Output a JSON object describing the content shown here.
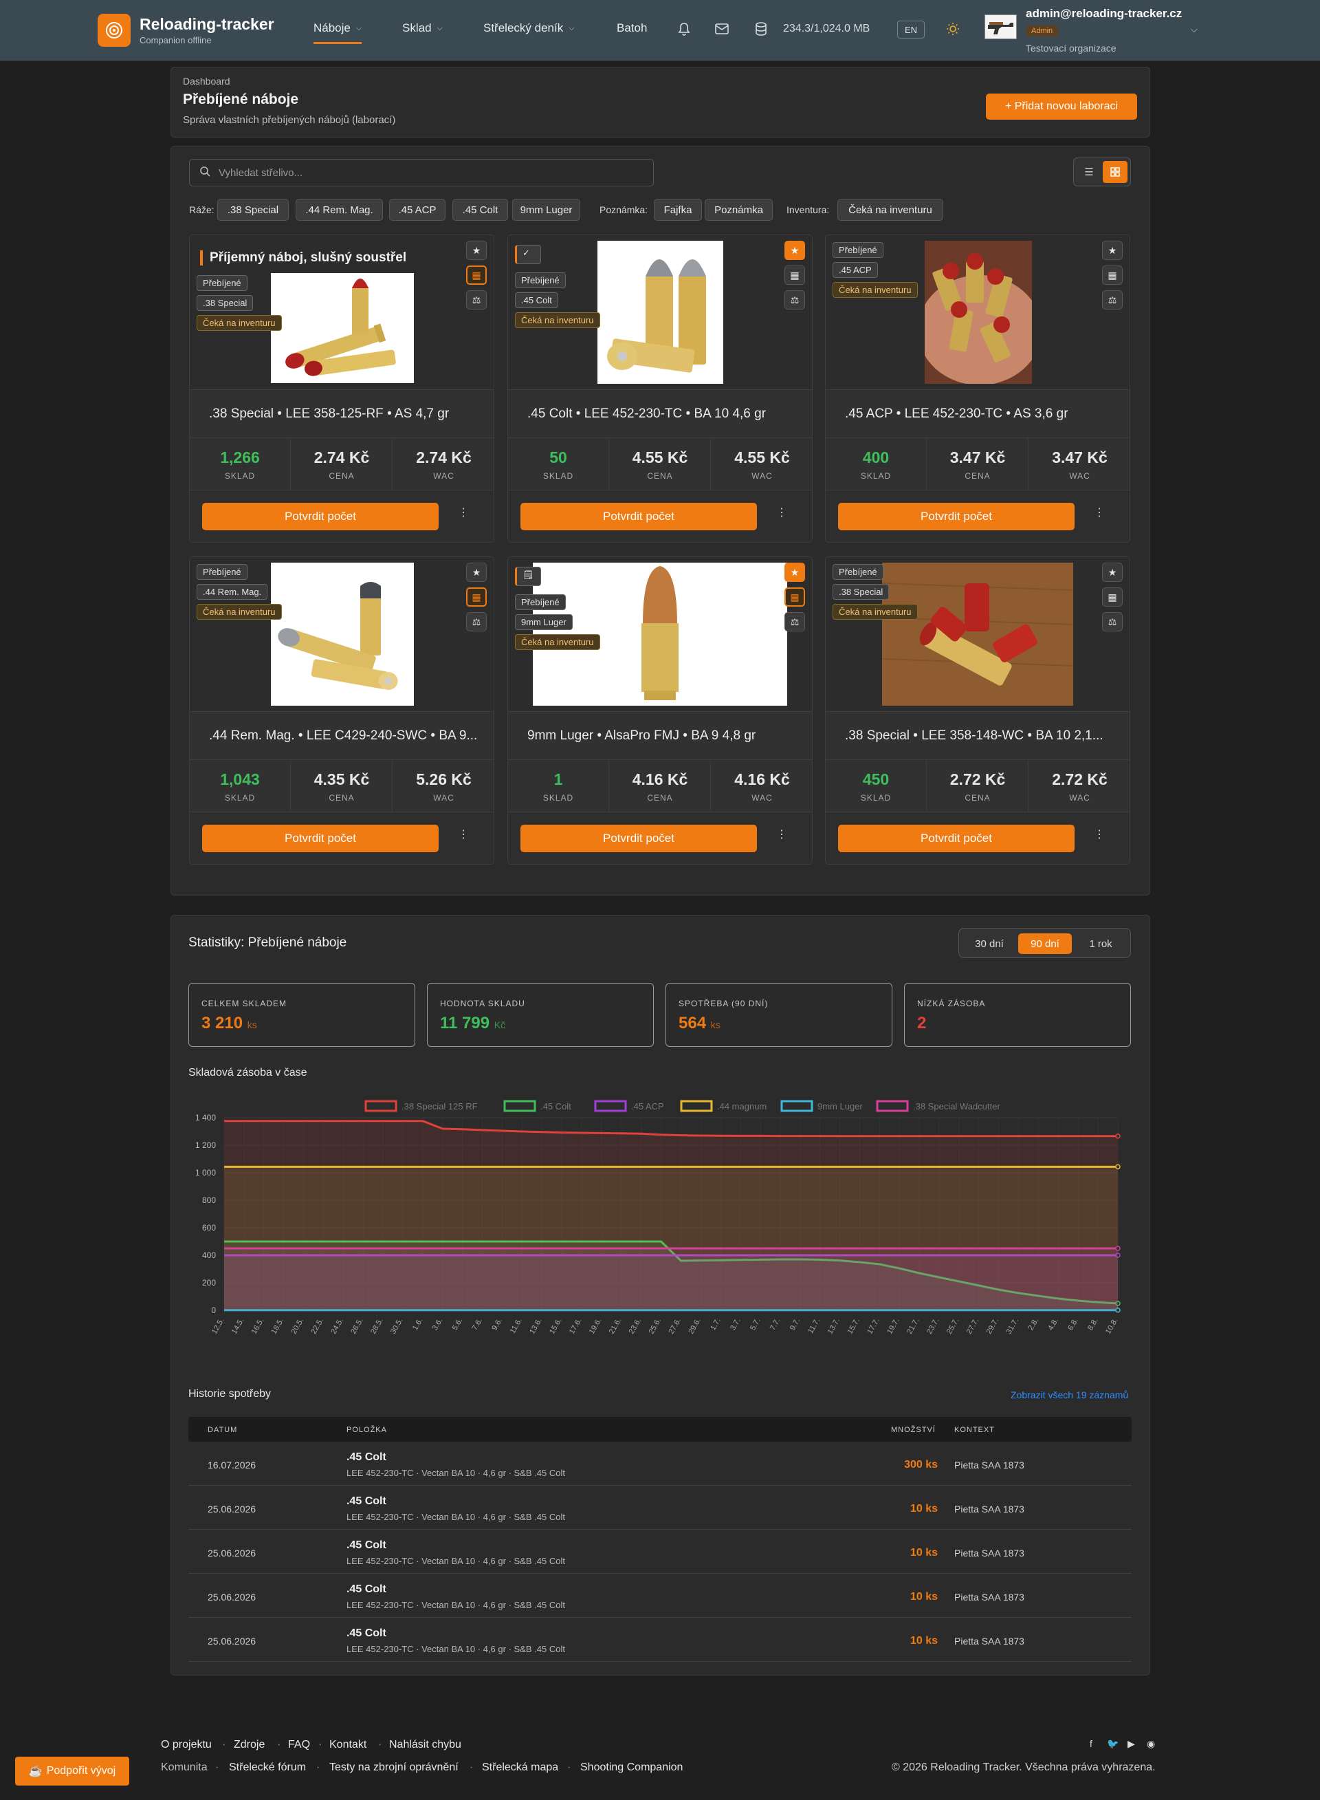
{
  "header": {
    "brand": "Reloading-tracker",
    "brand_sub": "Companion offline",
    "nav": [
      "Náboje",
      "Sklad",
      "Střelecký deník",
      "Batoh"
    ],
    "storage": "234.3/1,024.0 MB",
    "lang": "EN",
    "user_email": "admin@reloading-tracker.cz",
    "user_role": "Admin",
    "user_org": "Testovací organizace"
  },
  "page": {
    "breadcrumb": "Dashboard",
    "title": "Přebíjené náboje",
    "subtitle": "Správa vlastních přebíjených nábojů (laborací)",
    "add_button": "+ Přidat novou laboraci"
  },
  "filters": {
    "search_placeholder": "Vyhledat střelivo...",
    "caliber_label": "Ráže:",
    "calibers": [
      ".38 Special",
      ".44 Rem. Mag.",
      ".45 ACP",
      ".45 Colt",
      "9mm Luger"
    ],
    "note_label": "Poznámka:",
    "notes": [
      "Fajfka",
      "Poznámka"
    ],
    "inventory_label": "Inventura:",
    "inventory": [
      "Čeká na inventuru"
    ]
  },
  "cards": [
    {
      "title": "Příjemný náboj, slušný soustřel",
      "badges": [
        "Přebíjené",
        ".38 Special"
      ],
      "pending": "Čeká na inventuru",
      "name": ".38 Special • LEE 358-125-RF • AS 4,7 gr",
      "stock": "1,266",
      "price": "2.74 Kč",
      "wac": "2.74 Kč",
      "favorite": false
    },
    {
      "title": "",
      "badges": [
        "Přebíjené",
        ".45 Colt"
      ],
      "pending": "Čeká na inventuru",
      "name": ".45 Colt • LEE 452-230-TC • BA 10 4,6 gr",
      "stock": "50",
      "price": "4.55 Kč",
      "wac": "4.55 Kč",
      "favorite": true
    },
    {
      "title": "",
      "badges": [
        "Přebíjené",
        ".45 ACP"
      ],
      "pending": "Čeká na inventuru",
      "name": ".45 ACP • LEE 452-230-TC • AS 3,6 gr",
      "stock": "400",
      "price": "3.47 Kč",
      "wac": "3.47 Kč",
      "favorite": false
    },
    {
      "title": "",
      "badges": [
        "Přebíjené",
        ".44 Rem. Mag."
      ],
      "pending": "Čeká na inventuru",
      "name": ".44 Rem. Mag. • LEE C429-240-SWC • BA 9...",
      "stock": "1,043",
      "price": "4.35 Kč",
      "wac": "5.26 Kč",
      "favorite": false
    },
    {
      "title": "",
      "badges": [
        "Přebíjené",
        "9mm Luger"
      ],
      "pending": "Čeká na inventuru",
      "name": "9mm Luger • AlsaPro FMJ • BA 9 4,8 gr",
      "stock": "1",
      "price": "4.16 Kč",
      "wac": "4.16 Kč",
      "favorite": true
    },
    {
      "title": "",
      "badges": [
        "Přebíjené",
        ".38 Special"
      ],
      "pending": "Čeká na inventuru",
      "name": ".38 Special • LEE 358-148-WC • BA 10 2,1...",
      "stock": "450",
      "price": "2.72 Kč",
      "wac": "2.72 Kč",
      "favorite": false
    }
  ],
  "card_labels": {
    "stock": "SKLAD",
    "price": "CENA",
    "wac": "WAC",
    "confirm": "Potvrdit počet"
  },
  "stats": {
    "title": "Statistiky: Přebíjené náboje",
    "ranges": [
      "30 dní",
      "90 dní",
      "1 rok"
    ],
    "active_range": "90 dní",
    "kpis": [
      {
        "label": "CELKEM SKLADEM",
        "value": "3 210",
        "unit": "ks",
        "color": "#f07b12"
      },
      {
        "label": "HODNOTA SKLADU",
        "value": "11 799",
        "unit": "Kč",
        "color": "#3fbf5c"
      },
      {
        "label": "SPOTŘEBA (90 DNÍ)",
        "value": "564",
        "unit": "ks",
        "color": "#f07b12"
      },
      {
        "label": "NÍZKÁ ZÁSOBA",
        "value": "2",
        "unit": "",
        "color": "#e0413a"
      }
    ],
    "chart_title": "Skladová zásoba v čase"
  },
  "chart_data": {
    "type": "area",
    "title": "Skladová zásoba v čase",
    "x": [
      "12.5.",
      "14.5.",
      "16.5.",
      "18.5.",
      "20.5.",
      "22.5.",
      "24.5.",
      "26.5.",
      "28.5.",
      "30.5.",
      "1.6.",
      "3.6.",
      "5.6.",
      "7.6.",
      "9.6.",
      "11.6.",
      "13.6.",
      "15.6.",
      "17.6.",
      "19.6.",
      "21.6.",
      "23.6.",
      "25.6.",
      "27.6.",
      "29.6.",
      "1.7.",
      "3.7.",
      "5.7.",
      "7.7.",
      "9.7.",
      "11.7.",
      "13.7.",
      "15.7.",
      "17.7.",
      "19.7.",
      "21.7.",
      "23.7.",
      "25.7.",
      "27.7.",
      "29.7.",
      "31.7.",
      "2.8.",
      "4.8.",
      "6.8.",
      "8.8.",
      "10.8."
    ],
    "ylim": [
      0,
      1400
    ],
    "yticks": [
      "0",
      "200",
      "400",
      "600",
      "800",
      "1 000",
      "1 200",
      "1 400"
    ],
    "grid": true,
    "legend": "top",
    "series": [
      {
        "name": ".38 Special 125 RF",
        "color": "#e0413a",
        "values": [
          1376,
          1376,
          1376,
          1376,
          1376,
          1376,
          1376,
          1376,
          1376,
          1376,
          1376,
          1320,
          1316,
          1310,
          1305,
          1300,
          1296,
          1292,
          1290,
          1288,
          1286,
          1284,
          1276,
          1272,
          1270,
          1269,
          1268,
          1268,
          1267,
          1267,
          1267,
          1266,
          1266,
          1266,
          1266,
          1266,
          1266,
          1266,
          1266,
          1266,
          1266,
          1266,
          1266,
          1266,
          1266,
          1266
        ]
      },
      {
        "name": ".45 Colt",
        "color": "#3fbf5c",
        "values": [
          500,
          500,
          500,
          500,
          500,
          500,
          500,
          500,
          500,
          500,
          500,
          500,
          500,
          500,
          500,
          500,
          500,
          500,
          500,
          500,
          500,
          500,
          500,
          360,
          362,
          364,
          366,
          368,
          370,
          370,
          368,
          362,
          350,
          335,
          305,
          270,
          240,
          210,
          180,
          150,
          125,
          105,
          85,
          70,
          58,
          50
        ]
      },
      {
        "name": ".45 ACP",
        "color": "#a23fd6",
        "values": [
          400,
          400,
          400,
          400,
          400,
          400,
          400,
          400,
          400,
          400,
          400,
          400,
          400,
          400,
          400,
          400,
          400,
          400,
          400,
          400,
          400,
          400,
          400,
          400,
          400,
          400,
          400,
          400,
          400,
          400,
          400,
          400,
          400,
          400,
          400,
          400,
          400,
          400,
          400,
          400,
          400,
          400,
          400,
          400,
          400,
          400
        ]
      },
      {
        "name": ".44 magnum",
        "color": "#e6b830",
        "values": [
          1043,
          1043,
          1043,
          1043,
          1043,
          1043,
          1043,
          1043,
          1043,
          1043,
          1043,
          1043,
          1043,
          1043,
          1043,
          1043,
          1043,
          1043,
          1043,
          1043,
          1043,
          1043,
          1043,
          1043,
          1043,
          1043,
          1043,
          1043,
          1043,
          1043,
          1043,
          1043,
          1043,
          1043,
          1043,
          1043,
          1043,
          1043,
          1043,
          1043,
          1043,
          1043,
          1043,
          1043,
          1043,
          1043
        ]
      },
      {
        "name": "9mm Luger",
        "color": "#3fb7d6",
        "values": [
          1,
          1,
          1,
          1,
          1,
          1,
          1,
          1,
          1,
          1,
          1,
          1,
          1,
          1,
          1,
          1,
          1,
          1,
          1,
          1,
          1,
          1,
          1,
          1,
          1,
          1,
          1,
          1,
          1,
          1,
          1,
          1,
          1,
          1,
          1,
          1,
          1,
          1,
          1,
          1,
          1,
          1,
          1,
          1,
          1,
          1
        ]
      },
      {
        "name": ".38 Special Wadcutter",
        "color": "#d63f9a",
        "values": [
          450,
          450,
          450,
          450,
          450,
          450,
          450,
          450,
          450,
          450,
          450,
          450,
          450,
          450,
          450,
          450,
          450,
          450,
          450,
          450,
          450,
          450,
          450,
          450,
          450,
          450,
          450,
          450,
          450,
          450,
          450,
          450,
          450,
          450,
          450,
          450,
          450,
          450,
          450,
          450,
          450,
          450,
          450,
          450,
          450,
          450
        ]
      }
    ]
  },
  "history": {
    "title": "Historie spotřeby",
    "link": "Zobrazit všech 19 záznamů",
    "columns": [
      "DATUM",
      "POLOŽKA",
      "MNOŽSTVÍ",
      "KONTEXT"
    ],
    "rows": [
      {
        "date": "16.07.2026",
        "item": ".45 Colt",
        "sub": "LEE 452-230-TC · Vectan BA 10 · 4,6 gr · S&B .45 Colt",
        "qty": "300 ks",
        "ctx": "Pietta SAA 1873"
      },
      {
        "date": "25.06.2026",
        "item": ".45 Colt",
        "sub": "LEE 452-230-TC · Vectan BA 10 · 4,6 gr · S&B .45 Colt",
        "qty": "10 ks",
        "ctx": "Pietta SAA 1873"
      },
      {
        "date": "25.06.2026",
        "item": ".45 Colt",
        "sub": "LEE 452-230-TC · Vectan BA 10 · 4,6 gr · S&B .45 Colt",
        "qty": "10 ks",
        "ctx": "Pietta SAA 1873"
      },
      {
        "date": "25.06.2026",
        "item": ".45 Colt",
        "sub": "LEE 452-230-TC · Vectan BA 10 · 4,6 gr · S&B .45 Colt",
        "qty": "10 ks",
        "ctx": "Pietta SAA 1873"
      },
      {
        "date": "25.06.2026",
        "item": ".45 Colt",
        "sub": "LEE 452-230-TC · Vectan BA 10 · 4,6 gr · S&B .45 Colt",
        "qty": "10 ks",
        "ctx": "Pietta SAA 1873"
      }
    ]
  },
  "footer": {
    "support": "Podpořit vývoj",
    "links_row1": [
      "O projektu",
      "Zdroje",
      "FAQ",
      "Kontakt",
      "Nahlásit chybu"
    ],
    "links_row2": [
      "Komunita",
      "Střelecké fórum",
      "Testy na zbrojní oprávnění",
      "Střelecká mapa",
      "Shooting Companion"
    ],
    "copyright": "© 2026 Reloading Tracker. Všechna práva vyhrazena."
  }
}
